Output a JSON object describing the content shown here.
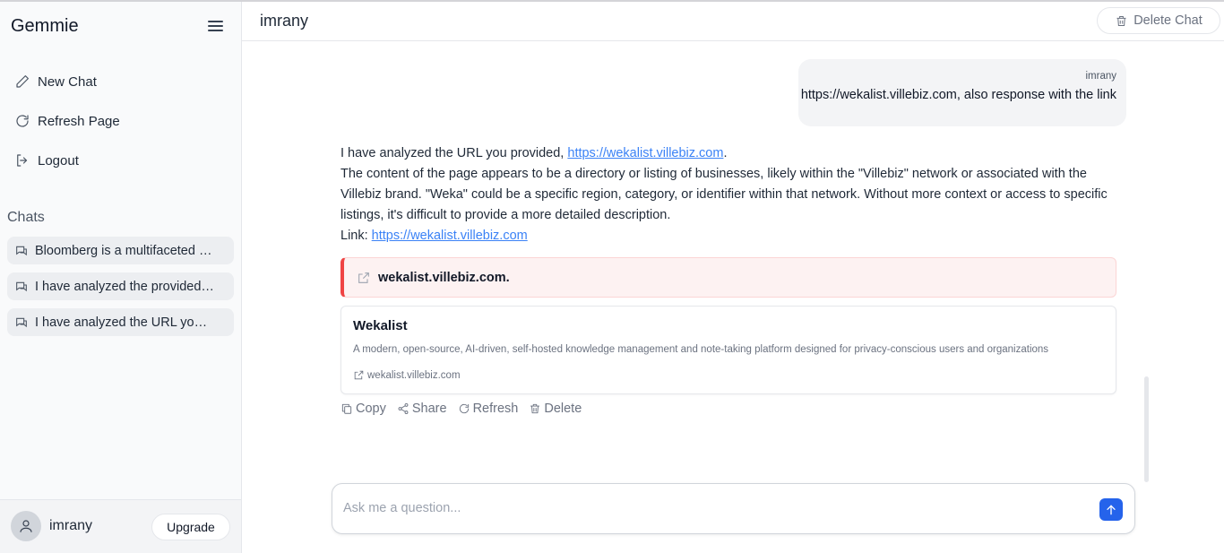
{
  "sidebar": {
    "brand": "Gemmie",
    "nav": {
      "new_chat": "New Chat",
      "refresh": "Refresh Page",
      "logout": "Logout"
    },
    "chats_label": "Chats",
    "chats": [
      {
        "title": "Bloomberg is a multifaceted global"
      },
      {
        "title": "I have analyzed the provided URL"
      },
      {
        "title": "I have analyzed the URL you provided"
      }
    ],
    "user": {
      "name": "imrany",
      "upgrade_label": "Upgrade"
    }
  },
  "header": {
    "title": "imrany",
    "delete_label": "Delete Chat"
  },
  "user_message": {
    "author": "imrany",
    "text": "https://wekalist.villebiz.com, also response with the link"
  },
  "assistant_message": {
    "intro": "I have analyzed the URL you provided, ",
    "intro_link": "https://wekalist.villebiz.com",
    "intro_end": ".",
    "body": "The content of the page appears to be a directory or listing of businesses, likely within the \"Villebiz\" network or associated with the Villebiz brand. \"Weka\" could be a specific region, category, or identifier within that network. Without more context or access to specific listings, it's difficult to provide a more detailed description.",
    "link_label": "Link: ",
    "link": "https://wekalist.villebiz.com"
  },
  "link_alert": {
    "text": "wekalist.villebiz.com."
  },
  "preview": {
    "title": "Wekalist",
    "description": "A modern, open-source, AI-driven, self-hosted knowledge management and note-taking platform designed for privacy-conscious users and organizations",
    "domain": "wekalist.villebiz.com"
  },
  "actions": {
    "copy": "Copy",
    "share": "Share",
    "refresh": "Refresh",
    "delete": "Delete"
  },
  "input": {
    "placeholder": "Ask me a question..."
  },
  "colors": {
    "accent": "#2563eb",
    "link": "#3b82f6",
    "alert_border": "#ef4444"
  }
}
